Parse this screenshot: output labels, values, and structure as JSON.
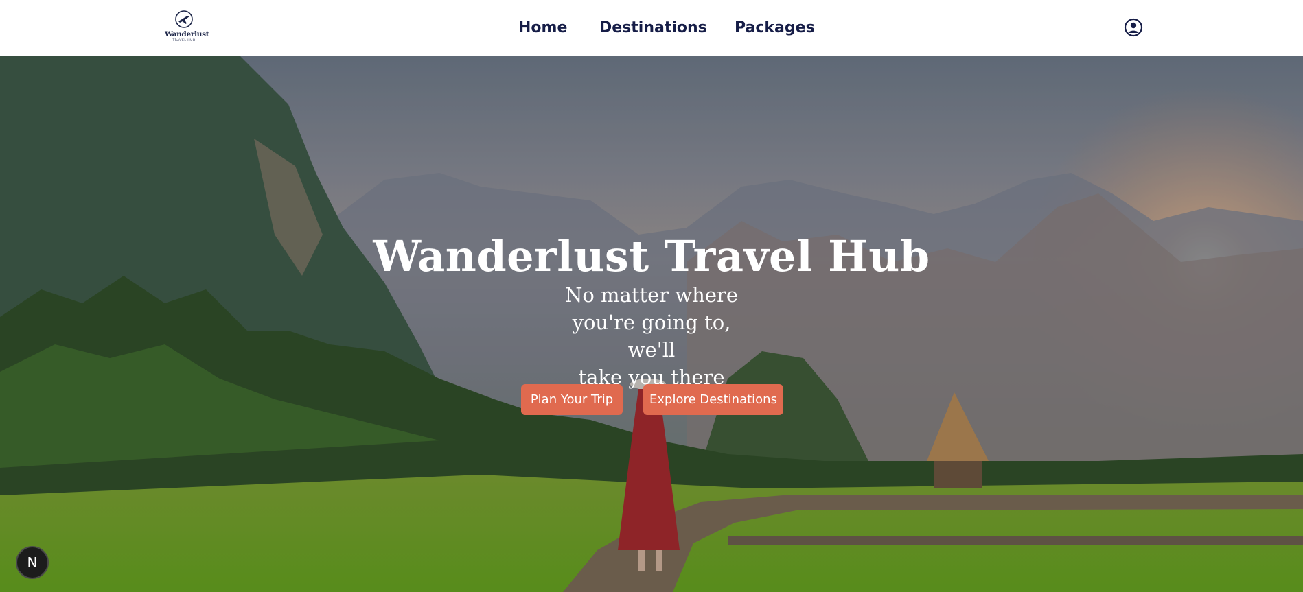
{
  "logo": {
    "name": "Wanderlust",
    "tagline": "TRAVEL HUB"
  },
  "nav": {
    "links": [
      {
        "label": "Home"
      },
      {
        "label": "Destinations"
      },
      {
        "label": "Packages"
      }
    ]
  },
  "hero": {
    "title": "Wanderlust Travel Hub",
    "subtitle_lines": [
      "No matter where",
      "you're going to, we'll",
      "take you there"
    ],
    "buttons": {
      "plan": "Plan Your Trip",
      "explore": "Explore Destinations"
    }
  },
  "badge": {
    "letter": "N"
  },
  "colors": {
    "nav_text": "#161d47",
    "button": "#e06a4f",
    "badge": "#1c1c1c"
  },
  "icons": {
    "logo": "plane-icon",
    "profile": "user-circle-icon"
  }
}
